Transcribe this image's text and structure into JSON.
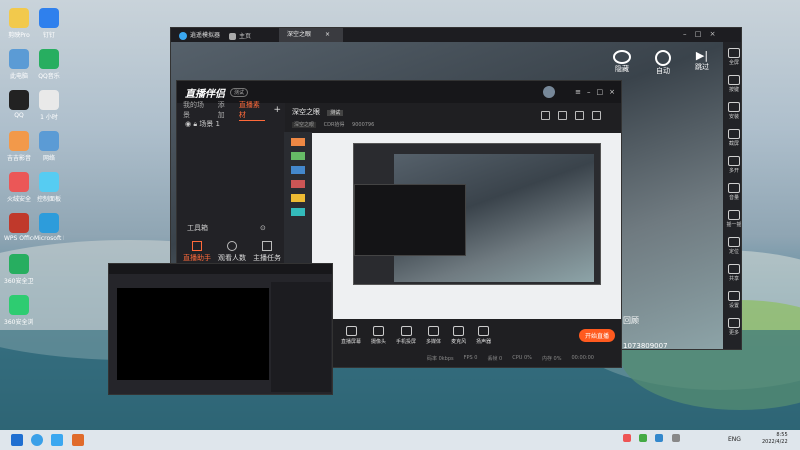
{
  "desktop": {
    "icons": [
      {
        "label": "剪映Pro"
      },
      {
        "label": "钉钉"
      },
      {
        "label": "此电脑"
      },
      {
        "label": "QQ音乐"
      },
      {
        "label": "QQ"
      },
      {
        "label": "1 小时"
      },
      {
        "label": "吉吉影音"
      },
      {
        "label": "网络"
      },
      {
        "label": "火绒安全"
      },
      {
        "label": "控制面板"
      },
      {
        "label": "WPS Office"
      },
      {
        "label": "Microsoft Edge"
      },
      {
        "label": "360安全卫士"
      },
      {
        "label": "360安全浏览器"
      }
    ]
  },
  "emulator": {
    "tabs": [
      {
        "label": "逍遥模拟器"
      },
      {
        "label": "主页"
      },
      {
        "label": "深空之眼"
      }
    ],
    "game_buttons": [
      {
        "label": "隐藏"
      },
      {
        "label": "自动"
      },
      {
        "label": "跳过"
      }
    ],
    "side_buttons": [
      {
        "label": "全屏"
      },
      {
        "label": "按键"
      },
      {
        "label": "安装"
      },
      {
        "label": "截屏"
      },
      {
        "label": "多开"
      },
      {
        "label": "音量"
      },
      {
        "label": "摇一摇"
      },
      {
        "label": "定位"
      },
      {
        "label": "共享"
      },
      {
        "label": "设置"
      },
      {
        "label": "更多"
      }
    ],
    "review_label": "回顾",
    "uid": "1073809007"
  },
  "obs": {
    "brand": "直播伴侣",
    "brand_tag": "测试",
    "left_tabs": [
      {
        "label": "我的场景"
      },
      {
        "label": "添加"
      },
      {
        "label": "直播素材"
      }
    ],
    "scene_name": "场景 1",
    "tools_label": "工具箱",
    "bottom_left_buttons": [
      {
        "label": "直播助手"
      },
      {
        "label": "观看人数"
      },
      {
        "label": "主播任务"
      }
    ],
    "game_title": "深空之眼",
    "game_tag": "测试",
    "stats": [
      "深空之眼",
      "CDR拾得",
      "9000796"
    ],
    "bottom_tools": [
      {
        "label": "直播屏幕"
      },
      {
        "label": "摄像头"
      },
      {
        "label": "手机投屏"
      },
      {
        "label": "多媒体"
      },
      {
        "label": "麦克风"
      },
      {
        "label": "扬声器"
      }
    ],
    "start_button": "开始直播",
    "status_items": [
      "码率 0kbps",
      "FPS 0",
      "丢帧 0",
      "CPU 0%",
      "内存 0%"
    ],
    "time": "00:00:00"
  },
  "taskbar": {
    "lang": "ENG",
    "time": "8:55",
    "date": "2022/4/22"
  },
  "colors": {
    "accent": "#ff5a1f",
    "obs_dark": "#1f1f22"
  }
}
